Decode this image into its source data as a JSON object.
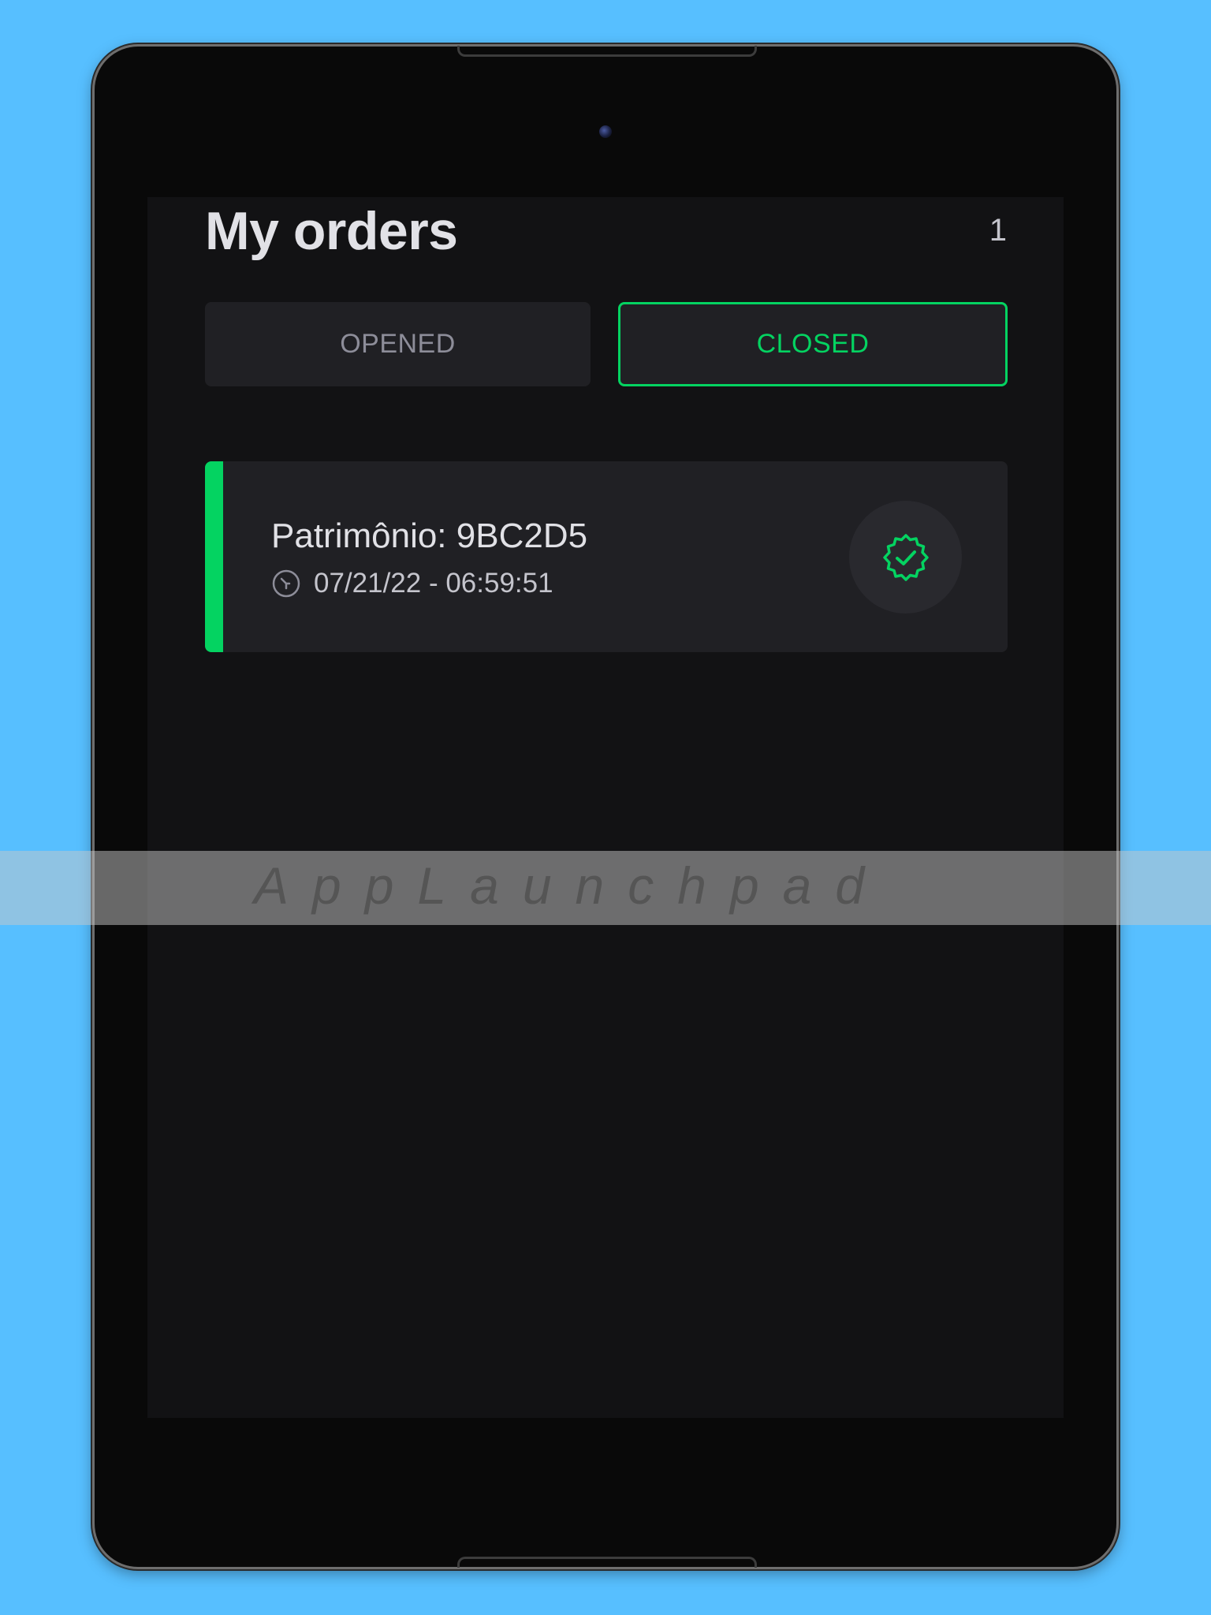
{
  "header": {
    "title": "My orders",
    "count": "1"
  },
  "tabs": [
    {
      "label": "OPENED",
      "active": false
    },
    {
      "label": "CLOSED",
      "active": true
    }
  ],
  "orders": [
    {
      "code": "Patrimônio: 9BC2D5",
      "datetime": "07/21/22 - 06:59:51",
      "status_icon": "verified-badge-icon",
      "accent_color": "#04d361"
    }
  ],
  "watermark": "AppLaunchpad",
  "colors": {
    "accent": "#04d361",
    "background": "#121214",
    "card": "#202024",
    "page_background": "#57bfff"
  }
}
